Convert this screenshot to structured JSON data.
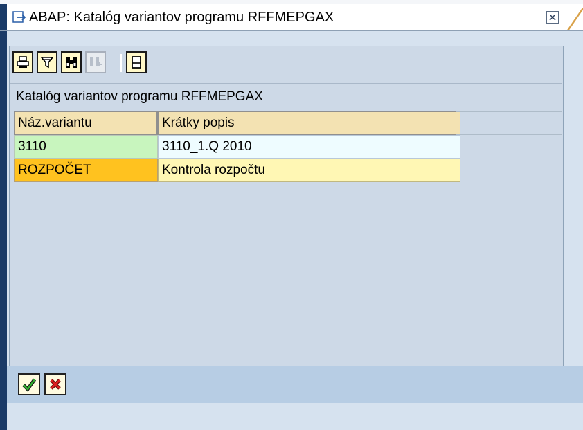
{
  "window": {
    "title": "ABAP: Katalóg variantov programu RFFMEPGAX"
  },
  "toolbar": {
    "buttons": [
      {
        "icon": "print-icon",
        "enabled": true
      },
      {
        "icon": "filter-icon",
        "enabled": true
      },
      {
        "icon": "find-icon",
        "enabled": true
      },
      {
        "icon": "find-next-icon",
        "enabled": false
      },
      {
        "icon": "document-icon",
        "enabled": true
      }
    ]
  },
  "catalog": {
    "title": "Katalóg variantov programu RFFMEPGAX",
    "columns": [
      "Náz.variantu",
      "Krátky popis"
    ],
    "rows": [
      {
        "name": "3110",
        "description": "3110_1.Q 2010"
      },
      {
        "name": "ROZPOČET",
        "description": "Kontrola rozpočtu"
      }
    ]
  },
  "footer": {
    "buttons": [
      {
        "icon": "checkmark-icon"
      },
      {
        "icon": "cancel-x-icon"
      }
    ]
  },
  "colors": {
    "frame_background": "#d6e2ef",
    "header_cell": "#f3e2b2",
    "row1_key": "#c8f5be",
    "row2_key": "#ffc21f",
    "row2_value": "#fff7b4"
  }
}
